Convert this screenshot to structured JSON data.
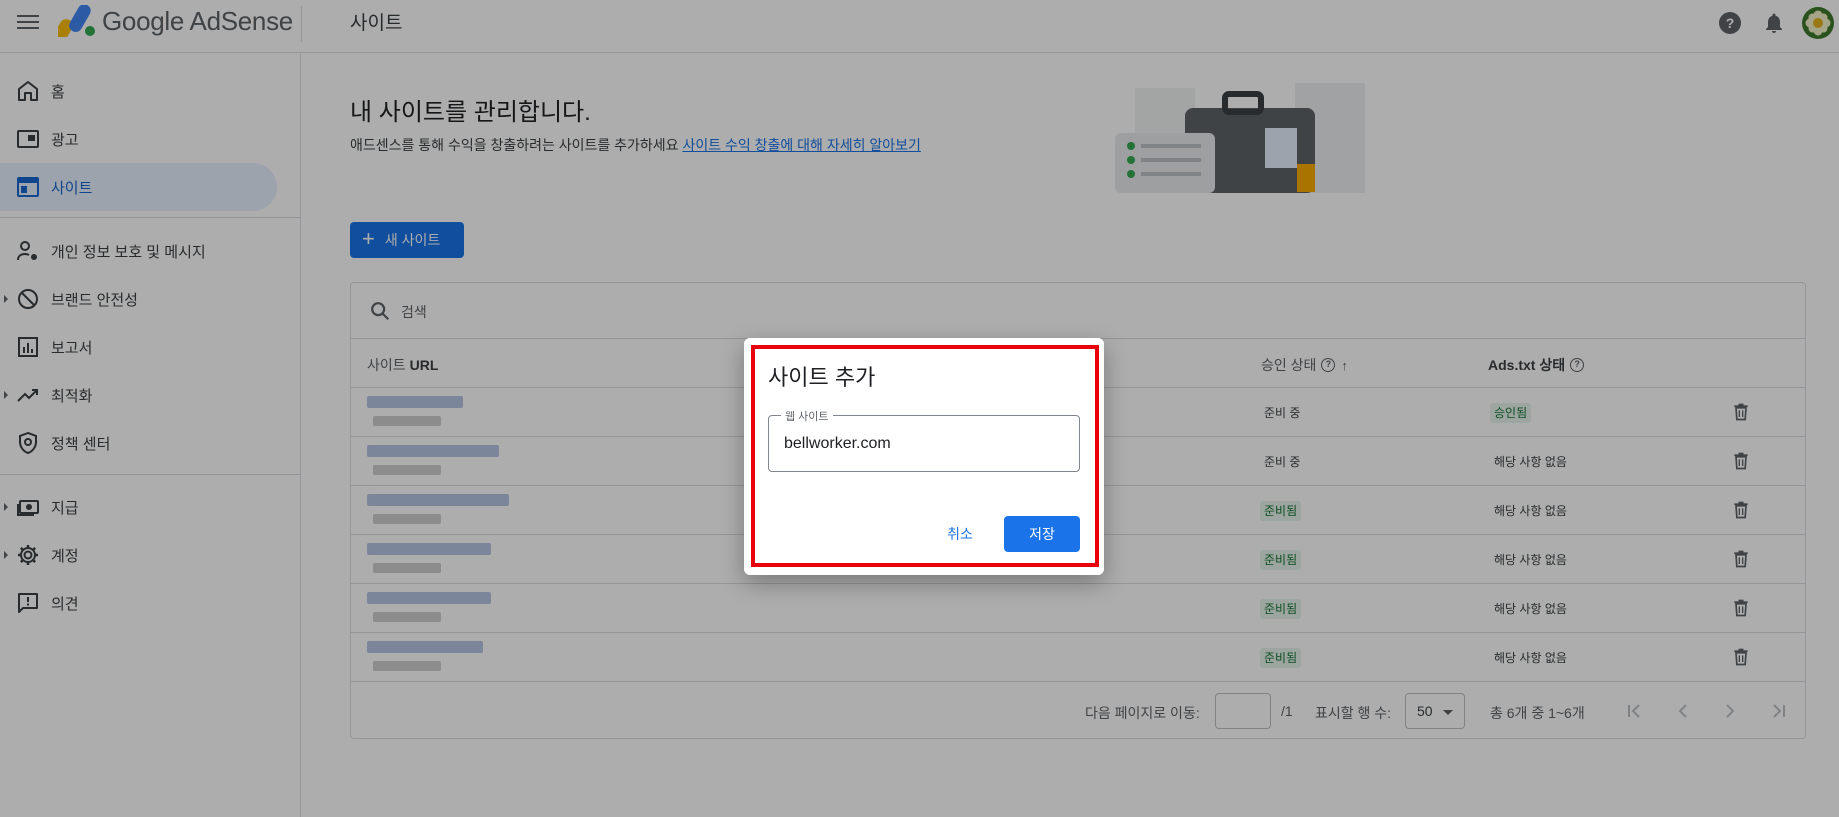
{
  "header": {
    "app_name": "Google AdSense",
    "page_title": "사이트"
  },
  "sidebar": {
    "items": [
      {
        "label": "홈",
        "icon": "home-icon"
      },
      {
        "label": "광고",
        "icon": "ads-icon"
      },
      {
        "label": "사이트",
        "icon": "sites-icon",
        "active": true
      },
      {
        "label": "개인 정보 보호 및 메시지",
        "icon": "privacy-icon"
      },
      {
        "label": "브랜드 안전성",
        "icon": "block-icon"
      },
      {
        "label": "보고서",
        "icon": "reports-icon"
      },
      {
        "label": "최적화",
        "icon": "trending-icon"
      },
      {
        "label": "정책 센터",
        "icon": "policy-icon"
      },
      {
        "label": "지급",
        "icon": "payments-icon"
      },
      {
        "label": "계정",
        "icon": "gear-icon"
      },
      {
        "label": "의견",
        "icon": "feedback-icon"
      }
    ]
  },
  "main": {
    "title": "내 사이트를 관리합니다.",
    "description": "애드센스를 통해 수익을 창출하려는 사이트를 추가하세요",
    "link_text": "사이트 수익 창출에 대해 자세히 알아보기",
    "new_site_label": "새 사이트",
    "search_placeholder": "검색"
  },
  "table": {
    "columns": {
      "site_url": "사이트",
      "site_url_bold": "URL",
      "approval_status": "승인 상태",
      "ads_txt_status": "Ads.txt 상태"
    },
    "rows": [
      {
        "approval": "준비 중",
        "ads_txt": "승인됨"
      },
      {
        "approval": "준비 중",
        "ads_txt": "해당 사항 없음"
      },
      {
        "approval": "준비됨",
        "ads_txt": "해당 사항 없음"
      },
      {
        "approval": "준비됨",
        "ads_txt": "해당 사항 없음"
      },
      {
        "approval": "준비됨",
        "ads_txt": "해당 사항 없음"
      },
      {
        "approval": "준비됨",
        "ads_txt": "해당 사항 없음"
      }
    ]
  },
  "pagination": {
    "goto_label": "다음 페이지로 이동:",
    "page_total": "/1",
    "rows_label": "표시할 행 수:",
    "rows_value": "50",
    "range": "총 6개 중 1~6개"
  },
  "dialog": {
    "title": "사이트 추가",
    "field_label": "웹 사이트",
    "field_value": "bellworker.com",
    "cancel": "취소",
    "save": "저장"
  },
  "colors": {
    "primary": "#1a73e8",
    "highlight_frame": "#e8000b",
    "approved_chip_bg": "#e6f4ea",
    "approved_chip_text": "#137333"
  }
}
